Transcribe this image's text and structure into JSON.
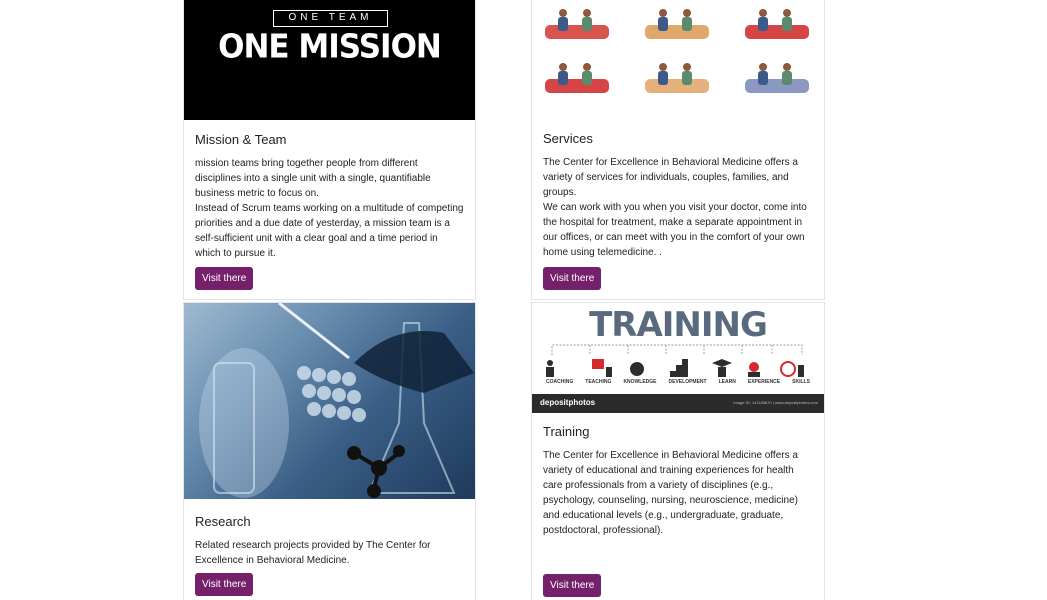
{
  "cards": [
    {
      "title": "Mission & Team",
      "paragraphs": [
        "mission teams bring together people from different disciplines into a single unit with a single, quantifiable business metric to focus on.",
        "Instead of Scrum teams working on a multitude of competing priorities and a due date of yesterday, a mission team is a self-sufficient unit with a clear goal and a time period in which to pursue it."
      ],
      "button": "Visit there",
      "image": {
        "top_text": "ONE TEAM",
        "main_text": "ONE MISSION"
      }
    },
    {
      "title": "Services",
      "paragraphs": [
        "The Center for Excellence in Behavioral Medicine offers a variety of services for individuals, couples, families, and groups.",
        "We can work with you when you visit your doctor, come into the hospital for treatment, make a separate appointment in our offices, or can meet with you in the comfort of your own home using telemedicine. ."
      ],
      "button": "Visit there"
    },
    {
      "title": "Research",
      "paragraphs": [
        "Related research projects provided by The Center for Excellence in Behavioral Medicine."
      ],
      "button": "Visit there"
    },
    {
      "title": "Training",
      "paragraphs": [
        "The Center for Excellence in Behavioral Medicine offers a variety of educational and training experiences for health care professionals from a variety of disciplines (e.g., psychology, counseling, nursing, neuroscience, medicine) and educational levels (e.g., undergraduate, graduate, postdoctoral, professional)."
      ],
      "button": "Visit there",
      "image": {
        "heading": "TRAINING",
        "labels": [
          "COACHING",
          "TEACHING",
          "KNOWLEDGE",
          "DEVELOPMENT",
          "LEARN",
          "EXPERIENCE",
          "SKILLS"
        ],
        "watermark": "depositphotos",
        "watermark_small": "Image ID: 141185870 | www.depositphotos.com"
      }
    }
  ],
  "colors": {
    "button": "#74206a"
  }
}
